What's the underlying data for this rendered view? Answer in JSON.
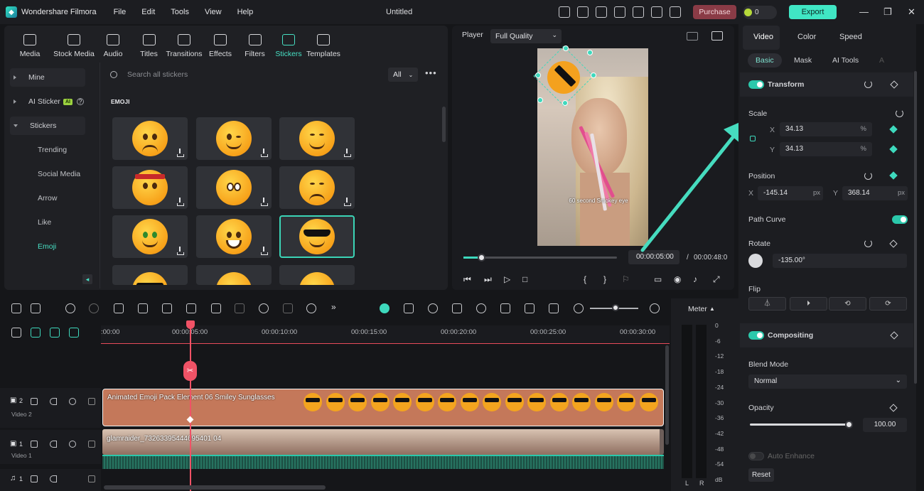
{
  "app": {
    "name": "Wondershare Filmora",
    "title": "Untitled"
  },
  "menu": [
    "File",
    "Edit",
    "Tools",
    "View",
    "Help"
  ],
  "topbar": {
    "purchase": "Purchase",
    "credits": "0",
    "export": "Export"
  },
  "media_tabs": [
    "Media",
    "Stock Media",
    "Audio",
    "Titles",
    "Transitions",
    "Effects",
    "Filters",
    "Stickers",
    "Templates"
  ],
  "sidebar": {
    "mine": "Mine",
    "ai_sticker": "AI Sticker",
    "ai_badge": "AI",
    "stickers": "Stickers",
    "sub": [
      "Trending",
      "Social Media",
      "Arrow",
      "Like",
      "Emoji"
    ]
  },
  "search": {
    "placeholder": "Search all stickers",
    "filter": "All"
  },
  "emoji_section": "EMOJI",
  "player": {
    "label": "Player",
    "quality": "Full Quality",
    "current": "00:00:05:00",
    "separator": "/",
    "total": "00:00:48:0",
    "caption": "60 second Smokey eye"
  },
  "props": {
    "tabs": [
      "Video",
      "Color",
      "Speed"
    ],
    "subtabs": [
      "Basic",
      "Mask",
      "AI Tools",
      "A"
    ],
    "transform": "Transform",
    "scale": "Scale",
    "scale_x": "34.13",
    "scale_y": "34.13",
    "x_label": "X",
    "y_label": "Y",
    "pct": "%",
    "px": "px",
    "position": "Position",
    "pos_x": "-145.14",
    "pos_y": "368.14",
    "path_curve": "Path Curve",
    "rotate": "Rotate",
    "rotate_val": "-135.00°",
    "flip": "Flip",
    "compositing": "Compositing",
    "blend_mode": "Blend Mode",
    "blend_val": "Normal",
    "opacity": "Opacity",
    "opacity_val": "100.00",
    "auto_enhance": "Auto Enhance",
    "reset": "Reset"
  },
  "timeline": {
    "ticks": [
      ":00:00",
      "00:00:05:00",
      "00:00:10:00",
      "00:00:15:00",
      "00:00:20:00",
      "00:00:25:00",
      "00:00:30:00"
    ],
    "video2": "Video 2",
    "video1": "Video 1",
    "track2_num": "2",
    "track1_num": "1",
    "audio_num": "1",
    "clip_emoji": "Animated Emoji Pack Element 06 Smiley Sunglasses",
    "clip_video": "glamraider_73263395444695401 04",
    "meter": "Meter",
    "meter_scale": [
      "0",
      "-6",
      "-12",
      "-18",
      "-24",
      "-30",
      "-36",
      "-42",
      "-48",
      "-54",
      "dB"
    ],
    "lr": [
      "L",
      "R"
    ]
  }
}
